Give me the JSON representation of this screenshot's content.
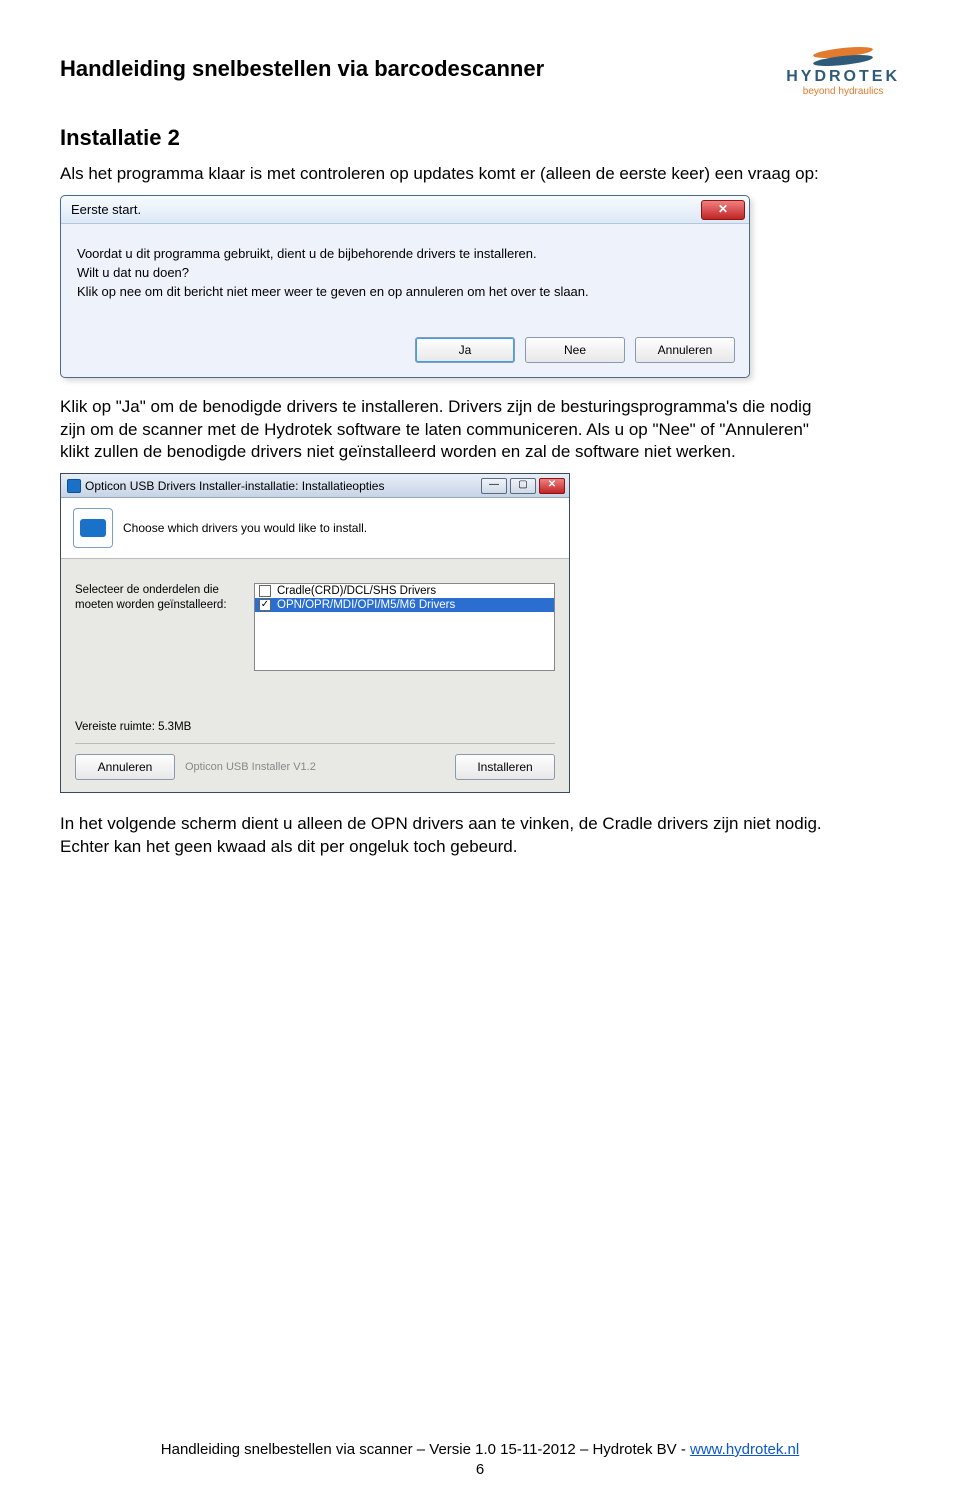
{
  "header": {
    "title": "Handleiding snelbestellen via barcodescanner",
    "logo_text": "HYDROTEK",
    "logo_sub": "beyond hydraulics"
  },
  "section_title": "Installatie 2",
  "intro_text": "Als het programma klaar is met controleren op updates komt er (alleen de eerste keer) een vraag op:",
  "dialog1": {
    "title": "Eerste start.",
    "line1": "Voordat u dit programma gebruikt, dient u de bijbehorende drivers te installeren.",
    "line2": "Wilt u dat nu doen?",
    "line3": "Klik op nee om dit bericht niet meer weer te geven en op annuleren om het over te slaan.",
    "btn_yes": "Ja",
    "btn_no": "Nee",
    "btn_cancel": "Annuleren"
  },
  "mid_text": "Klik op \"Ja\" om de benodigde drivers te installeren. Drivers zijn de besturingsprogramma's die nodig zijn om de scanner met de Hydrotek software te laten communiceren. Als u op \"Nee\" of \"Annuleren\" klikt zullen de benodigde drivers niet geïnstalleerd worden en zal de software niet werken.",
  "dialog2": {
    "title": "Opticon USB Drivers Installer-installatie: Installatieopties",
    "header_text": "Choose which drivers you would like to install.",
    "sel_label": "Selecteer de onderdelen die moeten worden geïnstalleerd:",
    "item1": "Cradle(CRD)/DCL/SHS Drivers",
    "item2": "OPN/OPR/MDI/OPI/M5/M6 Drivers",
    "req_text": "Vereiste ruimte: 5.3MB",
    "footer_hint": "Opticon USB Installer V1.2",
    "btn_cancel": "Annuleren",
    "btn_install": "Installeren"
  },
  "after_text": "In het volgende scherm dient u alleen de OPN drivers aan te vinken, de Cradle drivers zijn niet nodig. Echter kan het geen kwaad als dit per ongeluk toch gebeurd.",
  "footer": {
    "text_prefix": "Handleiding snelbestellen via scanner – Versie 1.0 15-11-2012 – Hydrotek BV - ",
    "link": "www.hydrotek.nl",
    "page_num": "6"
  }
}
